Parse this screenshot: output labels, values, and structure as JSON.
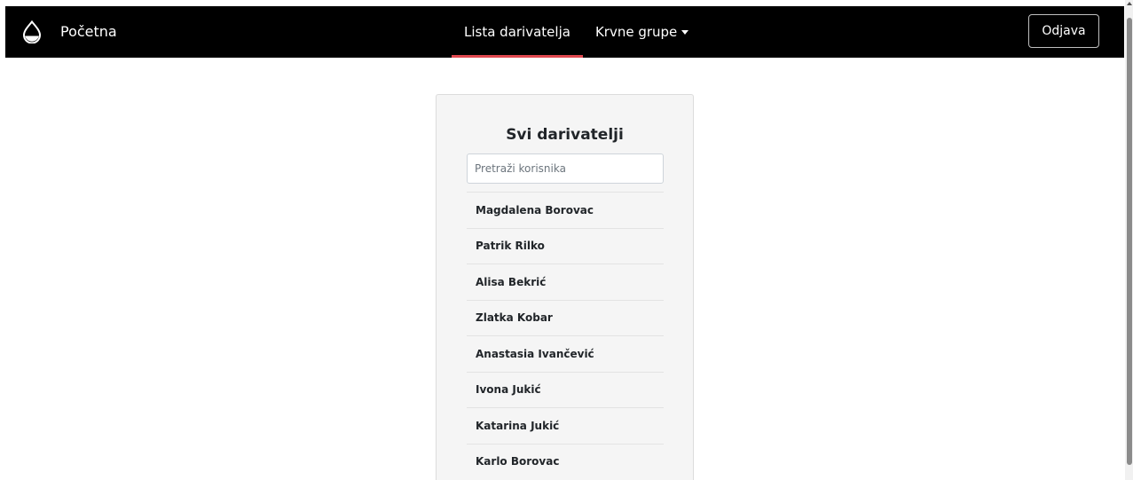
{
  "navbar": {
    "brand": {
      "icon": "blood-drop-icon",
      "label": "Početna"
    },
    "links": [
      {
        "label": "Lista darivatelja",
        "active": true
      },
      {
        "label": "Krvne grupe",
        "dropdown": true
      }
    ],
    "logout_label": "Odjava",
    "accent_color": "#e0484f",
    "background_color": "#000000"
  },
  "card": {
    "title": "Svi darivatelji",
    "search": {
      "placeholder": "Pretraži korisnika",
      "value": ""
    },
    "donors": [
      "Magdalena Borovac",
      "Patrik Rilko",
      "Alisa Bekrić",
      "Zlatka Kobar",
      "Anastasia Ivančević",
      "Ivona Jukić",
      "Katarina Jukić",
      "Karlo Borovac"
    ]
  }
}
